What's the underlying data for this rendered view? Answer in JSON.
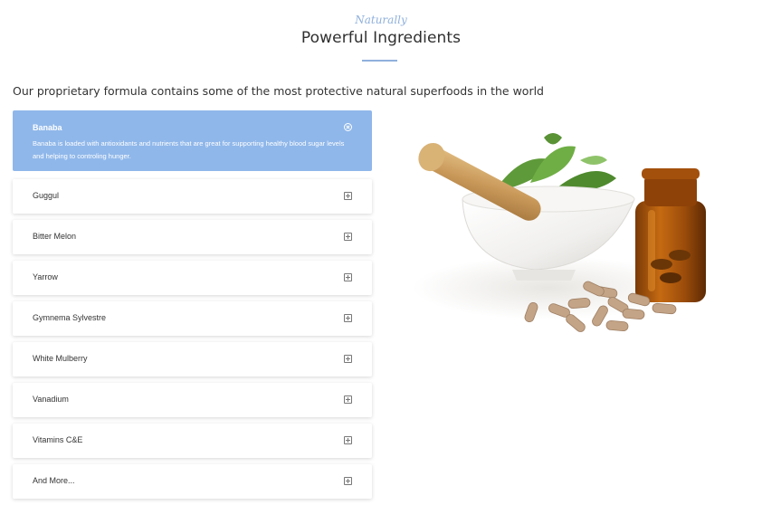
{
  "header": {
    "eyebrow": "Naturally",
    "title": "Powerful Ingredients"
  },
  "intro": "Our proprietary formula contains some of the most protective natural superfoods in the world",
  "accordion": {
    "open": {
      "label": "Banaba",
      "body": "Banaba is loaded with antioxidants and nutrients that are great for supporting healthy blood sugar levels and helping to controling hunger.",
      "icon": "close-circle-icon"
    },
    "items": [
      {
        "label": "Guggul",
        "icon": "plus-square-icon"
      },
      {
        "label": "Bitter Melon",
        "icon": "plus-square-icon"
      },
      {
        "label": "Yarrow",
        "icon": "plus-square-icon"
      },
      {
        "label": "Gymnema Sylvestre",
        "icon": "plus-square-icon"
      },
      {
        "label": "White Mulberry",
        "icon": "plus-square-icon"
      },
      {
        "label": "Vanadium",
        "icon": "plus-square-icon"
      },
      {
        "label": "Vitamins C&E",
        "icon": "plus-square-icon"
      },
      {
        "label": "And More...",
        "icon": "plus-square-icon"
      }
    ]
  },
  "colors": {
    "accent": "#8fb7ea",
    "eyebrow": "#8fb0dc",
    "text": "#333333"
  }
}
